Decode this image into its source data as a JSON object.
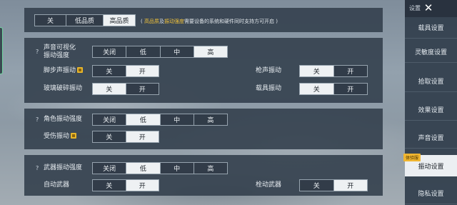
{
  "quality": {
    "options": [
      "关",
      "低品质",
      "高品质"
    ],
    "selected": 2,
    "note_prefix": "( ",
    "note_hl1": "高品质",
    "note_mid": "及",
    "note_hl2": "振动强度",
    "note_tail": "需要设备的系统和硬件同时支持方可开启 )"
  },
  "section1": {
    "sound_vis": {
      "help": "?",
      "label_line1": "声音可视化",
      "label_line2": "振动强度",
      "options": [
        "关闭",
        "低",
        "中",
        "高"
      ],
      "selected": 3
    },
    "footstep": {
      "label": "脚步声振动",
      "options": [
        "关",
        "开"
      ],
      "selected": 1
    },
    "gunshot": {
      "label": "枪声振动",
      "options": [
        "关",
        "开"
      ],
      "selected": 0
    },
    "glass": {
      "label": "玻璃破碎振动",
      "options": [
        "关",
        "开"
      ],
      "selected": 0
    },
    "vehicle": {
      "label": "载具振动",
      "options": [
        "关",
        "开"
      ],
      "selected": 0
    }
  },
  "section2": {
    "char_vib": {
      "help": "?",
      "label": "角色振动强度",
      "options": [
        "关闭",
        "低",
        "中",
        "高"
      ],
      "selected": 1
    },
    "hurt": {
      "label": "受伤振动",
      "options": [
        "关",
        "开"
      ],
      "selected": 1
    }
  },
  "section3": {
    "weapon_vib": {
      "help": "?",
      "label": "武器振动强度",
      "options": [
        "关闭",
        "低",
        "中",
        "高"
      ],
      "selected": 1
    },
    "auto_weapon": {
      "label": "自动武器",
      "options": [
        "关",
        "开"
      ],
      "selected": 1
    },
    "bolt_weapon": {
      "label": "栓动武器",
      "options": [
        "关",
        "开"
      ],
      "selected": 1
    }
  },
  "sidebar": {
    "title": "设置",
    "close_glyph": "✕",
    "items": [
      "载具设置",
      "灵敏度设置",
      "拾取设置",
      "效果设置",
      "声音设置",
      "振动设置",
      "隐私设置"
    ],
    "active": 5,
    "tag": "体验服"
  },
  "colors": {
    "active_bg": "#eef1f3",
    "highlight": "#f0c23a",
    "badge": "#e7b52a"
  }
}
